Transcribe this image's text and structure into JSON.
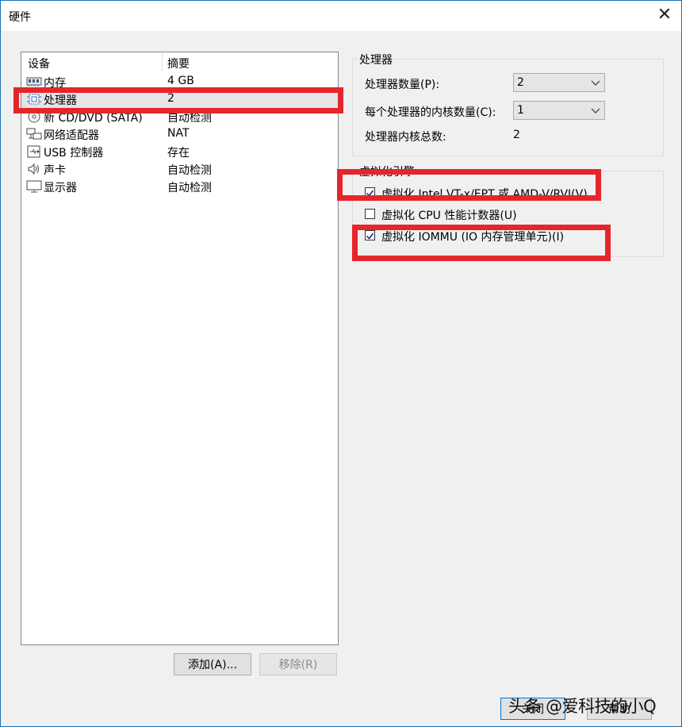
{
  "window": {
    "title": "硬件",
    "close_symbol": "✕"
  },
  "device_list": {
    "headers": {
      "device": "设备",
      "summary": "摘要"
    },
    "rows": [
      {
        "icon": "memory-icon",
        "name": "内存",
        "summary": "4 GB"
      },
      {
        "icon": "cpu-icon",
        "name": "处理器",
        "summary": "2",
        "selected": true
      },
      {
        "icon": "cd-icon",
        "name": "新 CD/DVD (SATA)",
        "summary": "自动检测"
      },
      {
        "icon": "network-icon",
        "name": "网络适配器",
        "summary": "NAT"
      },
      {
        "icon": "usb-icon",
        "name": "USB 控制器",
        "summary": "存在"
      },
      {
        "icon": "speaker-icon",
        "name": "声卡",
        "summary": "自动检测"
      },
      {
        "icon": "monitor-icon",
        "name": "显示器",
        "summary": "自动检测"
      }
    ],
    "buttons": {
      "add": "添加(A)...",
      "remove": "移除(R)"
    }
  },
  "processor_group": {
    "title": "处理器",
    "count_label": "处理器数量(P):",
    "count_value": "2",
    "cores_label": "每个处理器的内核数量(C):",
    "cores_value": "1",
    "total_label": "处理器内核总数:",
    "total_value": "2"
  },
  "virtualization_group": {
    "title": "虚拟化引擎",
    "options": [
      {
        "label": "虚拟化 Intel VT-x/EPT 或 AMD-V/RVI(V)",
        "checked": true
      },
      {
        "label": "虚拟化 CPU 性能计数器(U)",
        "checked": false
      },
      {
        "label": "虚拟化 IOMMU (IO 内存管理单元)(I)",
        "checked": true
      }
    ]
  },
  "footer": {
    "close": "关闭",
    "help": "帮助"
  },
  "watermark": "头条 @爱科技的小Q",
  "colors": {
    "highlight": "#e6252a",
    "selection": "#e5e5e5",
    "accent": "#0078d7"
  }
}
